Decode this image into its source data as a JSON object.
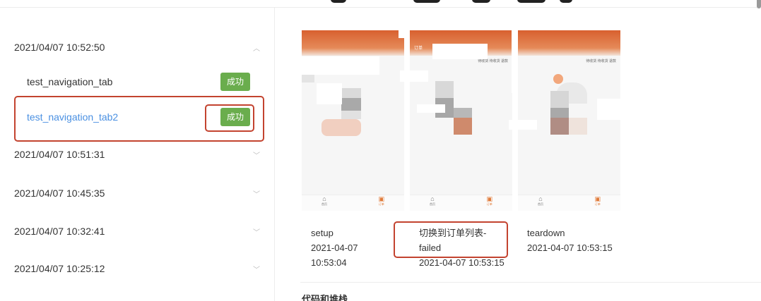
{
  "history": {
    "groups": [
      {
        "timestamp": "2021/04/07 10:52:50",
        "expanded": true,
        "cases": [
          {
            "name": "test_navigation_tab",
            "status": "成功",
            "active": false
          },
          {
            "name": "test_navigation_tab2",
            "status": "成功",
            "active": true
          }
        ]
      },
      {
        "timestamp": "2021/04/07 10:51:31",
        "expanded": false
      },
      {
        "timestamp": "2021/04/07 10:45:35",
        "expanded": false
      },
      {
        "timestamp": "2021/04/07 10:32:41",
        "expanded": false
      },
      {
        "timestamp": "2021/04/07 10:25:12",
        "expanded": false
      }
    ]
  },
  "icons": {
    "expanded": "chevron-up-icon",
    "collapsed": "chevron-down-icon",
    "home": "home-icon",
    "order": "order-icon"
  },
  "screenshots": [
    {
      "header_title": "",
      "tabs_text": "",
      "nav_home": "首页",
      "nav_order": "订单"
    },
    {
      "header_title": "订单",
      "tabs_text": "待收货   待收货   退款",
      "nav_home": "首页",
      "nav_order": "订单"
    },
    {
      "header_title": "",
      "tabs_text": "待收货   待收货   退款",
      "nav_home": "首页",
      "nav_order": "订单"
    }
  ],
  "steps": [
    {
      "name": "setup",
      "time_line1": "2021-04-07",
      "time_line2": "10:53:04"
    },
    {
      "name_line1": "切换到订单列表-",
      "name_line2": "failed",
      "time": "2021-04-07 10:53:15"
    },
    {
      "name": "teardown",
      "time": "2021-04-07 10:53:15"
    }
  ],
  "section": {
    "title": "代码和堆栈"
  },
  "colors": {
    "success": "#6aad4d",
    "active_link": "#4a90e2",
    "highlight": "#c3432f",
    "header_orange": "#d8602f"
  }
}
